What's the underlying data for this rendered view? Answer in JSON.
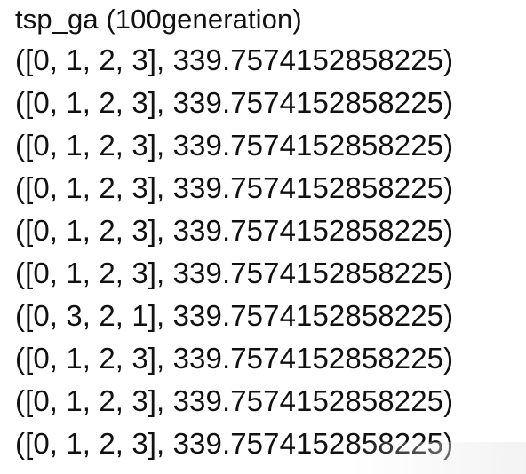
{
  "output": {
    "title": "tsp_ga (100generation)",
    "lines": [
      "([0, 1, 2, 3], 339.7574152858225)",
      "([0, 1, 2, 3], 339.7574152858225)",
      "([0, 1, 2, 3], 339.7574152858225)",
      "([0, 1, 2, 3], 339.7574152858225)",
      "([0, 1, 2, 3], 339.7574152858225)",
      "([0, 1, 2, 3], 339.7574152858225)",
      "([0, 3, 2, 1], 339.7574152858225)",
      "([0, 1, 2, 3], 339.7574152858225)",
      "([0, 1, 2, 3], 339.7574152858225)",
      "([0, 1, 2, 3], 339.7574152858225)"
    ]
  }
}
